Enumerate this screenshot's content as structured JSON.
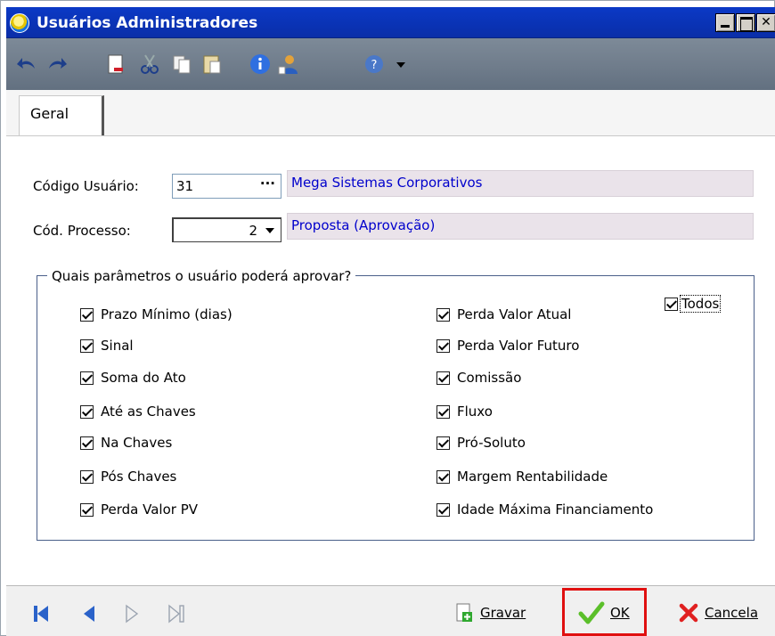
{
  "window": {
    "title": "Usuários Administradores"
  },
  "tabs": [
    {
      "label": "Geral"
    }
  ],
  "form": {
    "codigo_usuario_label": "Código Usuário:",
    "codigo_usuario_value": "31",
    "codigo_usuario_lookup": "···",
    "codigo_usuario_desc": "Mega Sistemas Corporativos",
    "cod_processo_label": "Cód. Processo:",
    "cod_processo_value": "2",
    "cod_processo_desc": "Proposta (Aprovação)"
  },
  "group": {
    "legend": "Quais parâmetros o usuário poderá aprovar?",
    "todos_label": "Todos",
    "left": [
      {
        "label": "Prazo Mínimo (dias)",
        "checked": true
      },
      {
        "label": "Sinal",
        "checked": true
      },
      {
        "label": "Soma do Ato",
        "checked": true
      },
      {
        "label": "Até as Chaves",
        "checked": true
      },
      {
        "label": "Na Chaves",
        "checked": true
      },
      {
        "label": "Pós Chaves",
        "checked": true
      },
      {
        "label": "Perda Valor PV",
        "checked": true
      }
    ],
    "right": [
      {
        "label": "Perda Valor Atual",
        "checked": true
      },
      {
        "label": "Perda Valor Futuro",
        "checked": true
      },
      {
        "label": "Comissão",
        "checked": true
      },
      {
        "label": "Fluxo",
        "checked": true
      },
      {
        "label": "Pró-Soluto",
        "checked": true
      },
      {
        "label": "Margem Rentabilidade",
        "checked": true
      },
      {
        "label": "Idade Máxima Financiamento",
        "checked": true
      }
    ]
  },
  "buttons": {
    "gravar": "Gravar",
    "ok": "OK",
    "cancela": "Cancela"
  },
  "colors": {
    "titlebar": "#0a2ea8",
    "toolbar": "#6e7b8a",
    "lookup_text": "#0000cc",
    "ok_highlight": "#e01010"
  }
}
